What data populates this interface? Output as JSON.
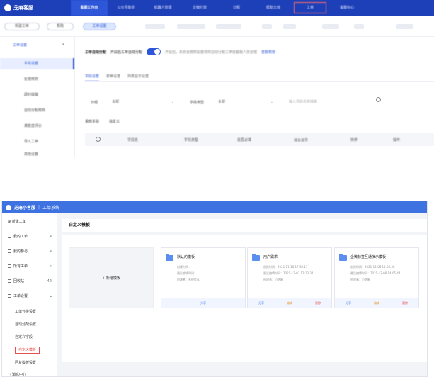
{
  "top": {
    "logo": "芝麻客服",
    "nav": [
      "客服工作台",
      "公众号助手",
      "机器人管理",
      "企微托管",
      "日程",
      "帮助文档",
      "工单",
      "客服中心"
    ],
    "nav_active_index": 0,
    "nav_outlined_index": 6,
    "toolbar": {
      "new_label": "新建工单",
      "help_label": "帮助",
      "active_label": "工单设置"
    },
    "sidebar": {
      "header": "工单设置",
      "items": [
        "字段设置",
        "处理规则",
        "超时提醒",
        "自动分配规则",
        "满意度评价",
        "导入工单",
        "其他设置"
      ],
      "active_index": 0
    },
    "toggle_row": {
      "title": "工单自动分配",
      "label": "开启后工单自动分配",
      "hint": "开启后，系统会按照配置规则自动分配工单给客服人员处理",
      "link": "查看帮助"
    },
    "tabs": [
      "字段设置",
      "表单设置",
      "列表显示设置"
    ],
    "tabs_active_index": 0,
    "filters": {
      "label1": "分组",
      "value1": "全部",
      "label2": "字段类型",
      "value2": "全部",
      "search_placeholder": "输入字段名称搜索"
    },
    "subtabs": [
      "系统字段",
      "自定义"
    ],
    "table_headers": [
      "字段名",
      "字段类型",
      "是否必填",
      "是否显示",
      "排序",
      "操作"
    ]
  },
  "bottom": {
    "brand": "芝麻小客服",
    "section": "工单系统",
    "sidebar": {
      "items": [
        {
          "label": "新建工单",
          "arrow": "",
          "count": ""
        },
        {
          "label": "我的工单",
          "arrow": "▾",
          "count": ""
        },
        {
          "label": "我的参与",
          "arrow": "▾",
          "count": ""
        },
        {
          "label": "所有工单",
          "arrow": "▾",
          "count": ""
        },
        {
          "label": "回收站",
          "arrow": "",
          "count": "42"
        },
        {
          "label": "工单设置",
          "arrow": "▴",
          "count": ""
        }
      ],
      "subitems": [
        "工单分类设置",
        "自动分配设置",
        "自定义字段",
        "自定义模板",
        "回复模板设置"
      ],
      "highlight_index": 3,
      "footer": "消息中心"
    },
    "page_title": "自定义模板",
    "add_label": "+ 新增模板",
    "templates": [
      {
        "name": "默认的模板",
        "created": "创建时间：",
        "modified": "最后编辑时间：",
        "creator": "创建者：系统默认"
      },
      {
        "name": "用户需求",
        "created": "创建时间：2021-11-16 17:30:17",
        "modified": "最后编辑时间：2021-12-02 12:13:34",
        "creator": "创建者：小芝麻"
      },
      {
        "name": "企微标签互通演示模板",
        "created": "创建时间：2021-12-08 14:05:36",
        "modified": "最后编辑时间：2021-12-08 14:05:44",
        "creator": "创建者：小芝麻"
      }
    ],
    "actions": {
      "share": "分享",
      "edit": "编辑",
      "delete": "删除"
    }
  }
}
